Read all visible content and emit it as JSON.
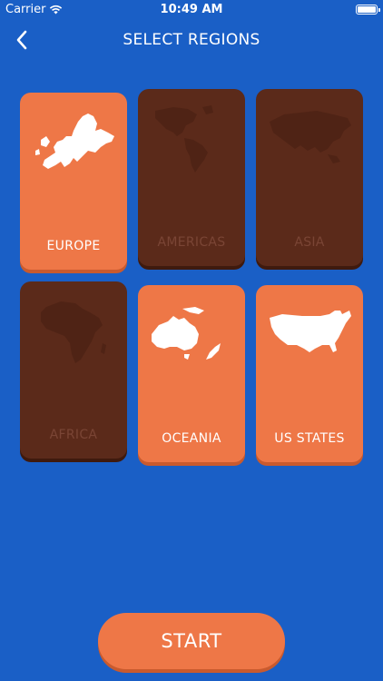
{
  "status_bar": {
    "carrier": "Carrier",
    "time": "10:49 AM",
    "battery_level": 1.0
  },
  "nav": {
    "title": "SELECT REGIONS",
    "back_icon": "chevron-left-icon"
  },
  "regions": [
    {
      "label": "EUROPE",
      "selected": true
    },
    {
      "label": "AMERICAS",
      "selected": false
    },
    {
      "label": "ASIA",
      "selected": false
    },
    {
      "label": "AFRICA",
      "selected": false
    },
    {
      "label": "OCEANIA",
      "selected": true
    },
    {
      "label": "US STATES",
      "selected": true
    }
  ],
  "start_button": {
    "label": "START"
  },
  "colors": {
    "background": "#1a5fc6",
    "selected_card": "#ee7747",
    "unselected_card": "#5b2a1a"
  }
}
